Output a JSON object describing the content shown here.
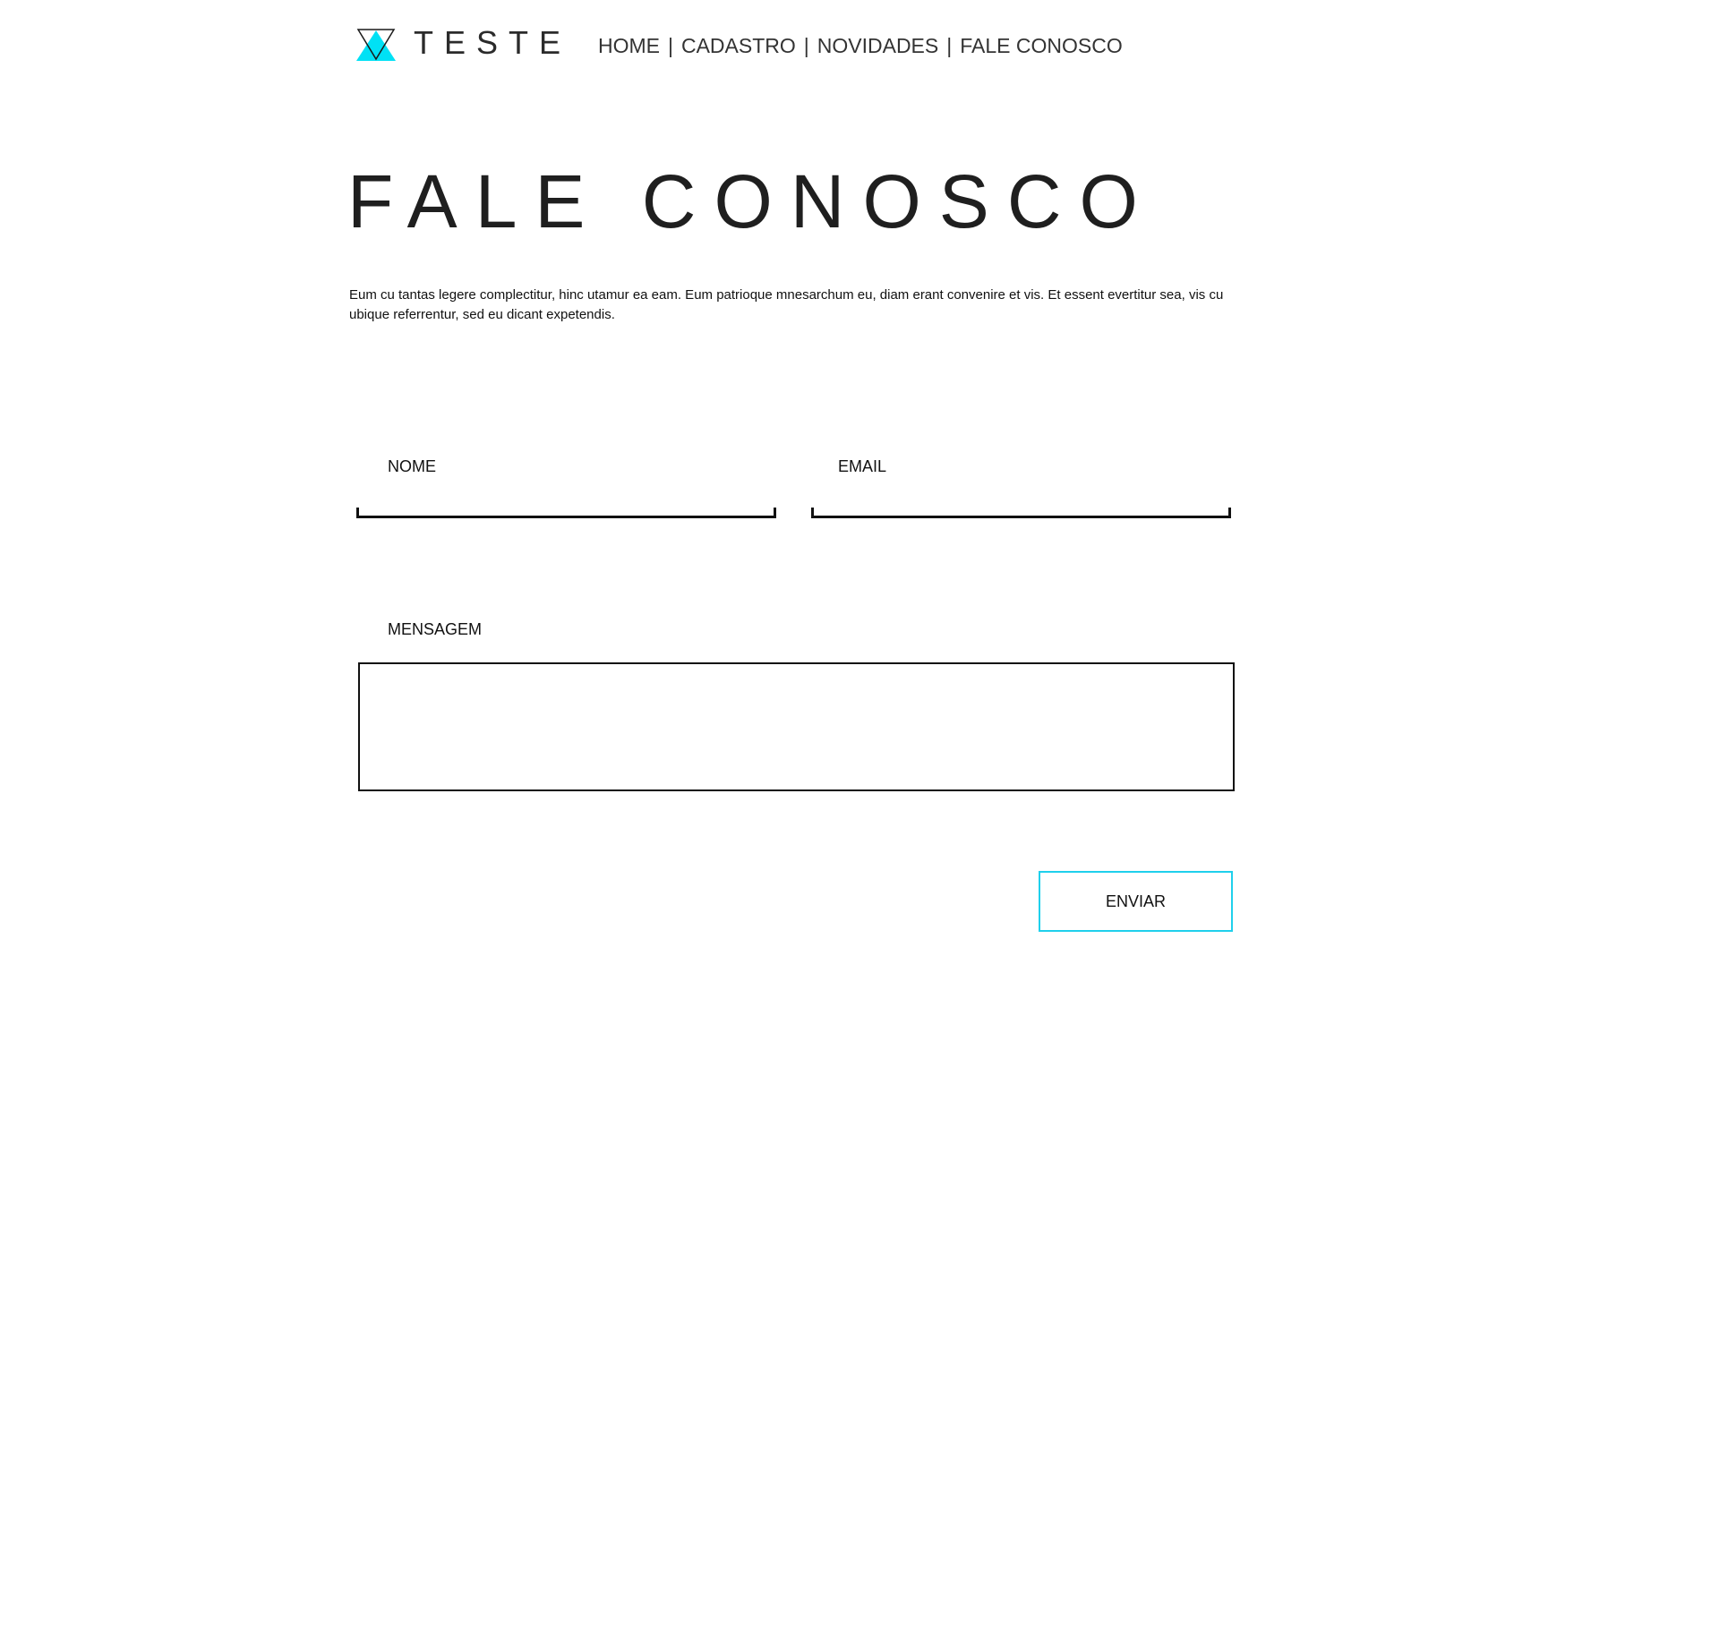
{
  "header": {
    "logo_text": "TESTE",
    "nav": {
      "items": [
        "HOME",
        "CADASTRO",
        "NOVIDADES",
        "FALE CONOSCO"
      ],
      "separator": "|"
    }
  },
  "page": {
    "title": "FALE CONOSCO",
    "intro": "Eum cu tantas legere complectitur, hinc utamur ea eam. Eum patrioque mnesarchum eu, diam erant convenire et vis. Et essent evertitur sea, vis cu ubique referrentur, sed eu dicant expetendis."
  },
  "form": {
    "nome_label": "NOME",
    "nome_value": "",
    "email_label": "EMAIL",
    "email_value": "",
    "mensagem_label": "MENSAGEM",
    "mensagem_value": "",
    "submit_label": "ENVIAR"
  },
  "colors": {
    "accent": "#1fd0ec",
    "text": "#222222",
    "border": "#111111"
  },
  "icons": {
    "logo": "triangle-logo-icon"
  }
}
